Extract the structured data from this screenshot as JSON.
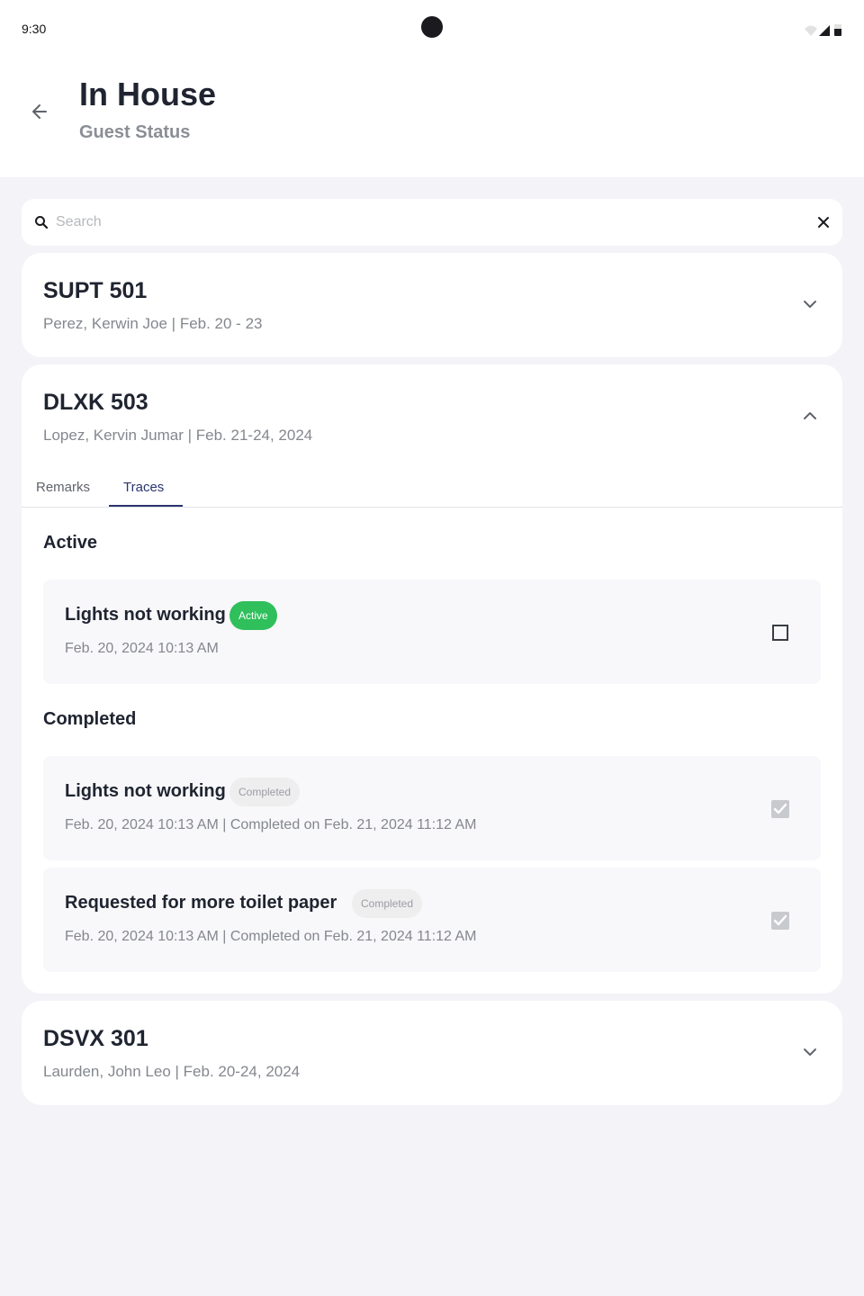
{
  "statusbar": {
    "time": "9:30"
  },
  "header": {
    "title": "In House",
    "subtitle": "Guest Status"
  },
  "search": {
    "placeholder": "Search",
    "value": ""
  },
  "rooms": [
    {
      "code": "SUPT 501",
      "guest": "Perez, Kerwin Joe | Feb. 20 - 23",
      "expanded": false
    },
    {
      "code": "DLXK 503",
      "guest": "Lopez, Kervin Jumar | Feb. 21-24, 2024",
      "expanded": true,
      "tabs": [
        {
          "label": "Remarks",
          "selected": false
        },
        {
          "label": "Traces",
          "selected": true
        }
      ],
      "active_section": "Active",
      "completed_section": "Completed",
      "active_traces": [
        {
          "title": "Lights not working",
          "badge": "Active",
          "meta": "Feb. 20, 2024 10:13 AM",
          "checked": false
        }
      ],
      "completed_traces": [
        {
          "title": "Lights not working",
          "badge": "Completed",
          "meta": "Feb. 20, 2024 10:13 AM | Completed on Feb. 21, 2024 11:12 AM",
          "checked": true
        },
        {
          "title": "Requested for more toilet paper",
          "badge": "Completed",
          "meta": "Feb. 20, 2024 10:13 AM | Completed on Feb. 21, 2024 11:12 AM",
          "checked": true
        }
      ]
    },
    {
      "code": "DSVX 301",
      "guest": "Laurden, John Leo | Feb. 20-24, 2024",
      "expanded": false
    }
  ],
  "colors": {
    "background": "#f3f3f8",
    "active_badge": "#2fbf5b",
    "tab_accent": "#2a3470",
    "muted_text": "#84878e"
  }
}
